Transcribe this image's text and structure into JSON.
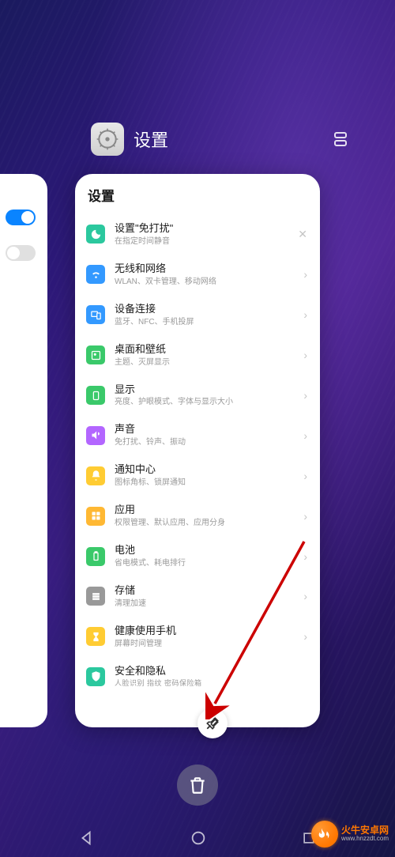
{
  "header": {
    "app_title": "设置"
  },
  "card": {
    "title": "设置",
    "rows": [
      {
        "title": "设置\"免打扰\"",
        "subtitle": "在指定时间静音",
        "closable": true
      },
      {
        "title": "无线和网络",
        "subtitle": "WLAN、双卡管理、移动网络"
      },
      {
        "title": "设备连接",
        "subtitle": "蓝牙、NFC、手机投屏"
      },
      {
        "title": "桌面和壁纸",
        "subtitle": "主题、灭屏显示"
      },
      {
        "title": "显示",
        "subtitle": "亮度、护眼模式、字体与显示大小"
      },
      {
        "title": "声音",
        "subtitle": "免打扰、铃声、振动"
      },
      {
        "title": "通知中心",
        "subtitle": "图标角标、锁屏通知"
      },
      {
        "title": "应用",
        "subtitle": "权限管理、默认应用、应用分身"
      },
      {
        "title": "电池",
        "subtitle": "省电模式、耗电排行"
      },
      {
        "title": "存储",
        "subtitle": "清理加速"
      },
      {
        "title": "健康使用手机",
        "subtitle": "屏幕时间管理"
      },
      {
        "title": "安全和隐私",
        "subtitle": "人脸识别  指纹        密码保险箱"
      }
    ]
  },
  "watermark": {
    "brand": "火牛安卓网",
    "url": "www.hnzzdt.com"
  }
}
